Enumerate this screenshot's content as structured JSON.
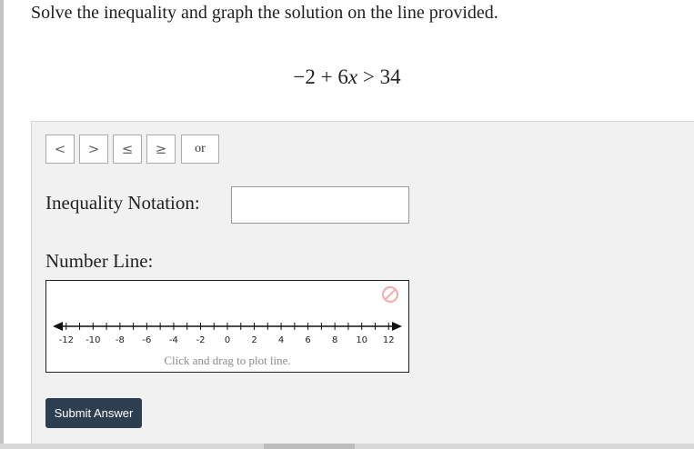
{
  "question": {
    "prompt": "Solve the inequality and graph the solution on the line provided.",
    "expression": {
      "lhs_const": "−2",
      "op1": "+",
      "coef": "6",
      "var": "x",
      "relation": ">",
      "rhs": "34"
    }
  },
  "toolbar": {
    "symbols": [
      {
        "label": "<",
        "icon": "less-than"
      },
      {
        "label": ">",
        "icon": "greater-than"
      },
      {
        "label": "≤",
        "icon": "less-than-or-equal"
      },
      {
        "label": "≥",
        "icon": "greater-than-or-equal"
      },
      {
        "label": "or",
        "icon": "or"
      }
    ]
  },
  "inequality": {
    "label": "Inequality Notation:",
    "value": ""
  },
  "number_line": {
    "label": "Number Line:",
    "hint": "Click and drag to plot line.",
    "min": -13,
    "max": 13,
    "ticks": [
      -12,
      -11,
      -10,
      -9,
      -8,
      -7,
      -6,
      -5,
      -4,
      -3,
      -2,
      -1,
      0,
      1,
      2,
      3,
      4,
      5,
      6,
      7,
      8,
      9,
      10,
      11,
      12
    ],
    "tick_labels": [
      "-12",
      "-10",
      "-8",
      "-6",
      "-4",
      "-2",
      "0",
      "2",
      "4",
      "6",
      "8",
      "10",
      "12"
    ],
    "clear_icon": "no-entry-icon",
    "clear_color": "#f4b0b0"
  },
  "submit": {
    "label": "Submit Answer",
    "color": "#2c3e50"
  }
}
